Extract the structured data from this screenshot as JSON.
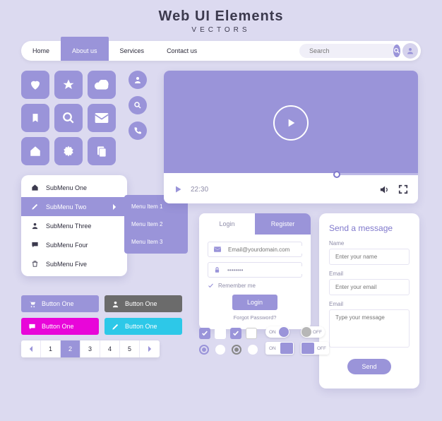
{
  "title": "Web UI Elements",
  "subtitle": "VECTORS",
  "nav": {
    "items": [
      "Home",
      "About us",
      "Services",
      "Contact us"
    ],
    "active_index": 1,
    "search_placeholder": "Search"
  },
  "icon_tiles": [
    "heart-icon",
    "star-icon",
    "cloud-icon",
    "bookmark-icon",
    "search-icon",
    "mail-icon",
    "home-icon",
    "gear-icon",
    "document-icon"
  ],
  "circle_icons": [
    "user-icon",
    "search-icon",
    "phone-icon"
  ],
  "submenu": {
    "items": [
      {
        "icon": "home-icon",
        "label": "SubMenu One"
      },
      {
        "icon": "pencil-icon",
        "label": "SubMenu Two",
        "selected": true
      },
      {
        "icon": "user-icon",
        "label": "SubMenu Three"
      },
      {
        "icon": "chat-icon",
        "label": "SubMenu Four"
      },
      {
        "icon": "trash-icon",
        "label": "SubMenu Five"
      }
    ],
    "flyout": [
      "Menu Item 1",
      "Menu Item 2",
      "Menu Item 3"
    ]
  },
  "buttons": [
    {
      "icon": "cart-icon",
      "label": "Button One",
      "color": "purple"
    },
    {
      "icon": "user-icon",
      "label": "Button One",
      "color": "gray"
    },
    {
      "icon": "chat-icon",
      "label": "Button One",
      "color": "magenta"
    },
    {
      "icon": "pencil-icon",
      "label": "Button One",
      "color": "teal"
    }
  ],
  "pagination": {
    "pages": [
      "1",
      "2",
      "3",
      "4",
      "5"
    ],
    "current": 2
  },
  "video": {
    "time": "22:30",
    "progress_pct": 68
  },
  "login": {
    "tabs": [
      "Login",
      "Register"
    ],
    "active_tab": 0,
    "email_placeholder": "Email@yourdomain.com",
    "password_value": "••••••••",
    "remember_label": "Remember me",
    "submit_label": "Login",
    "forgot_label": "Forgot Password?"
  },
  "contact": {
    "title": "Send a message",
    "fields": [
      {
        "label": "Name",
        "placeholder": "Enter your name"
      },
      {
        "label": "Email",
        "placeholder": "Enter your email"
      },
      {
        "label": "Email",
        "placeholder": "Type your message",
        "multiline": true
      }
    ],
    "submit": "Send"
  },
  "toggles": {
    "on_label": "ON",
    "off_label": "OFF"
  },
  "colors": {
    "purple": "#9A94D9",
    "teal": "#2DC8E8",
    "magenta": "#E806D9",
    "gray": "#6B6B6B"
  }
}
